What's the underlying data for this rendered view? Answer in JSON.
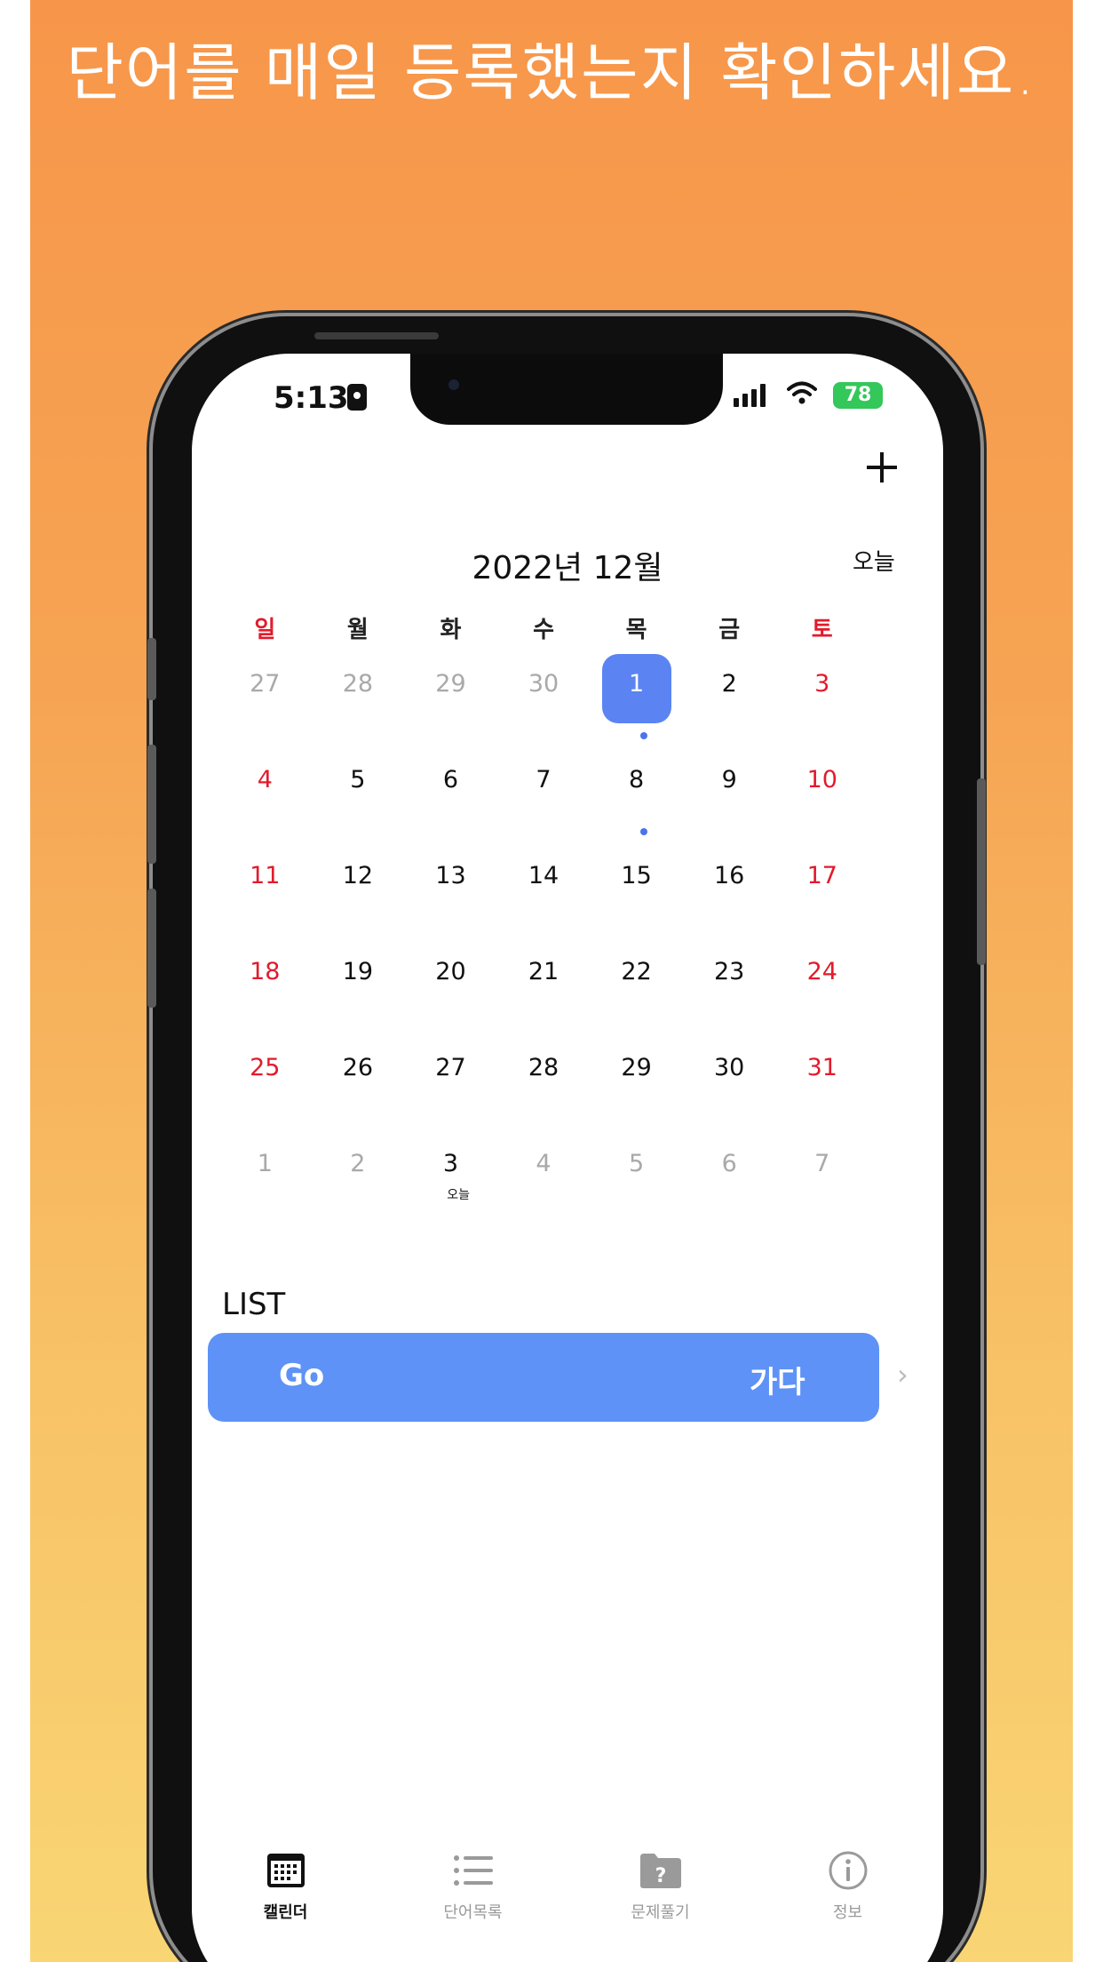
{
  "headline": "단어를 매일 등록했는지 확인하세요.",
  "status_bar": {
    "time": "5:13",
    "battery": "78"
  },
  "header": {
    "add_icon": "plus-icon",
    "month_title": "2022년 12월",
    "today_button": "오늘"
  },
  "weekdays": [
    "일",
    "월",
    "화",
    "수",
    "목",
    "금",
    "토"
  ],
  "calendar": {
    "weeks": [
      [
        {
          "n": "27",
          "muted": true
        },
        {
          "n": "28",
          "muted": true
        },
        {
          "n": "29",
          "muted": true
        },
        {
          "n": "30",
          "muted": true
        },
        {
          "n": "1",
          "selected": true,
          "dot": true
        },
        {
          "n": "2"
        },
        {
          "n": "3",
          "red": true
        }
      ],
      [
        {
          "n": "4",
          "red": true
        },
        {
          "n": "5"
        },
        {
          "n": "6"
        },
        {
          "n": "7"
        },
        {
          "n": "8",
          "dot": true
        },
        {
          "n": "9"
        },
        {
          "n": "10",
          "red": true
        }
      ],
      [
        {
          "n": "11",
          "red": true
        },
        {
          "n": "12"
        },
        {
          "n": "13"
        },
        {
          "n": "14"
        },
        {
          "n": "15"
        },
        {
          "n": "16"
        },
        {
          "n": "17",
          "red": true
        }
      ],
      [
        {
          "n": "18",
          "red": true
        },
        {
          "n": "19"
        },
        {
          "n": "20"
        },
        {
          "n": "21"
        },
        {
          "n": "22"
        },
        {
          "n": "23"
        },
        {
          "n": "24",
          "red": true
        }
      ],
      [
        {
          "n": "25",
          "red": true
        },
        {
          "n": "26"
        },
        {
          "n": "27"
        },
        {
          "n": "28"
        },
        {
          "n": "29"
        },
        {
          "n": "30"
        },
        {
          "n": "31",
          "red": true
        }
      ],
      [
        {
          "n": "1",
          "muted": true
        },
        {
          "n": "2",
          "muted": true
        },
        {
          "n": "3",
          "sub": "오늘"
        },
        {
          "n": "4",
          "muted": true
        },
        {
          "n": "5",
          "muted": true
        },
        {
          "n": "6",
          "muted": true
        },
        {
          "n": "7",
          "muted": true
        }
      ]
    ]
  },
  "list": {
    "label": "LIST",
    "items": [
      {
        "word": "Go",
        "meaning": "가다"
      }
    ]
  },
  "tabs": [
    {
      "label": "캘린더",
      "icon": "calendar-icon",
      "active": true
    },
    {
      "label": "단어목록",
      "icon": "list-icon",
      "active": false
    },
    {
      "label": "문제풀기",
      "icon": "question-folder-icon",
      "active": false
    },
    {
      "label": "정보",
      "icon": "info-icon",
      "active": false
    }
  ],
  "colors": {
    "accent": "#5b84f2",
    "card": "#5e92f6",
    "weekend_red": "#e21b2c"
  }
}
